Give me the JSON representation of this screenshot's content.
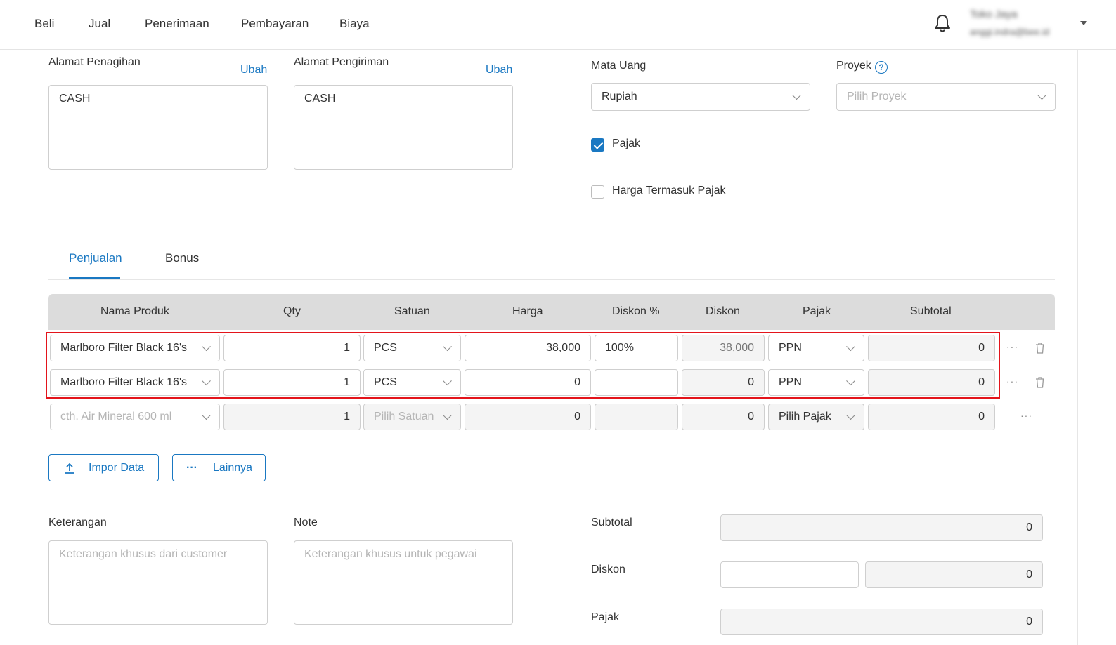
{
  "nav": {
    "items": [
      "Beli",
      "Jual",
      "Penerimaan",
      "Pembayaran",
      "Biaya"
    ],
    "user_name": "Toko Jaya",
    "user_email": "anggi.indra@bee.id"
  },
  "address": {
    "billing_label": "Alamat Penagihan",
    "billing_change": "Ubah",
    "billing_value": "CASH",
    "shipping_label": "Alamat Pengiriman",
    "shipping_change": "Ubah",
    "shipping_value": "CASH"
  },
  "currency": {
    "label": "Mata Uang",
    "value": "Rupiah"
  },
  "project": {
    "label": "Proyek",
    "help": "?",
    "placeholder": "Pilih Proyek"
  },
  "tax": {
    "tax_label": "Pajak",
    "tax_checked": true,
    "incl_label": "Harga Termasuk Pajak",
    "incl_checked": false
  },
  "tabs": {
    "sales": "Penjualan",
    "bonus": "Bonus",
    "active": "sales"
  },
  "table": {
    "headers": [
      "Nama Produk",
      "Qty",
      "Satuan",
      "Harga",
      "Diskon %",
      "Diskon",
      "Pajak",
      "Subtotal"
    ],
    "rows": [
      {
        "product": "Marlboro Filter Black 16's",
        "qty": "1",
        "unit": "PCS",
        "price": "38,000",
        "disc_pct": "100%",
        "disc": "38,000",
        "tax": "PPN",
        "subtotal": "0"
      },
      {
        "product": "Marlboro Filter Black 16's",
        "qty": "1",
        "unit": "PCS",
        "price": "0",
        "disc_pct": "",
        "disc": "0",
        "tax": "PPN",
        "subtotal": "0"
      }
    ],
    "new_row": {
      "product_placeholder": "cth. Air Mineral 600 ml",
      "qty": "1",
      "unit_placeholder": "Pilih Satuan",
      "price": "0",
      "disc": "0",
      "tax_placeholder": "Pilih Pajak",
      "subtotal": "0"
    },
    "more": "···"
  },
  "actions": {
    "import": "Impor Data",
    "more": "Lainnya",
    "more_icon": "···"
  },
  "notes": {
    "remarks_label": "Keterangan",
    "remarks_placeholder": "Keterangan khusus dari customer",
    "note_label": "Note",
    "note_placeholder": "Keterangan khusus untuk pegawai"
  },
  "summary": {
    "subtotal_label": "Subtotal",
    "subtotal_value": "0",
    "discount_label": "Diskon",
    "discount_input": "",
    "discount_value": "0",
    "tax_label": "Pajak",
    "tax_value": "0"
  },
  "colors": {
    "accent": "#1a78c2",
    "highlight": "#e3141b",
    "header_bg": "#dcdcdc"
  }
}
